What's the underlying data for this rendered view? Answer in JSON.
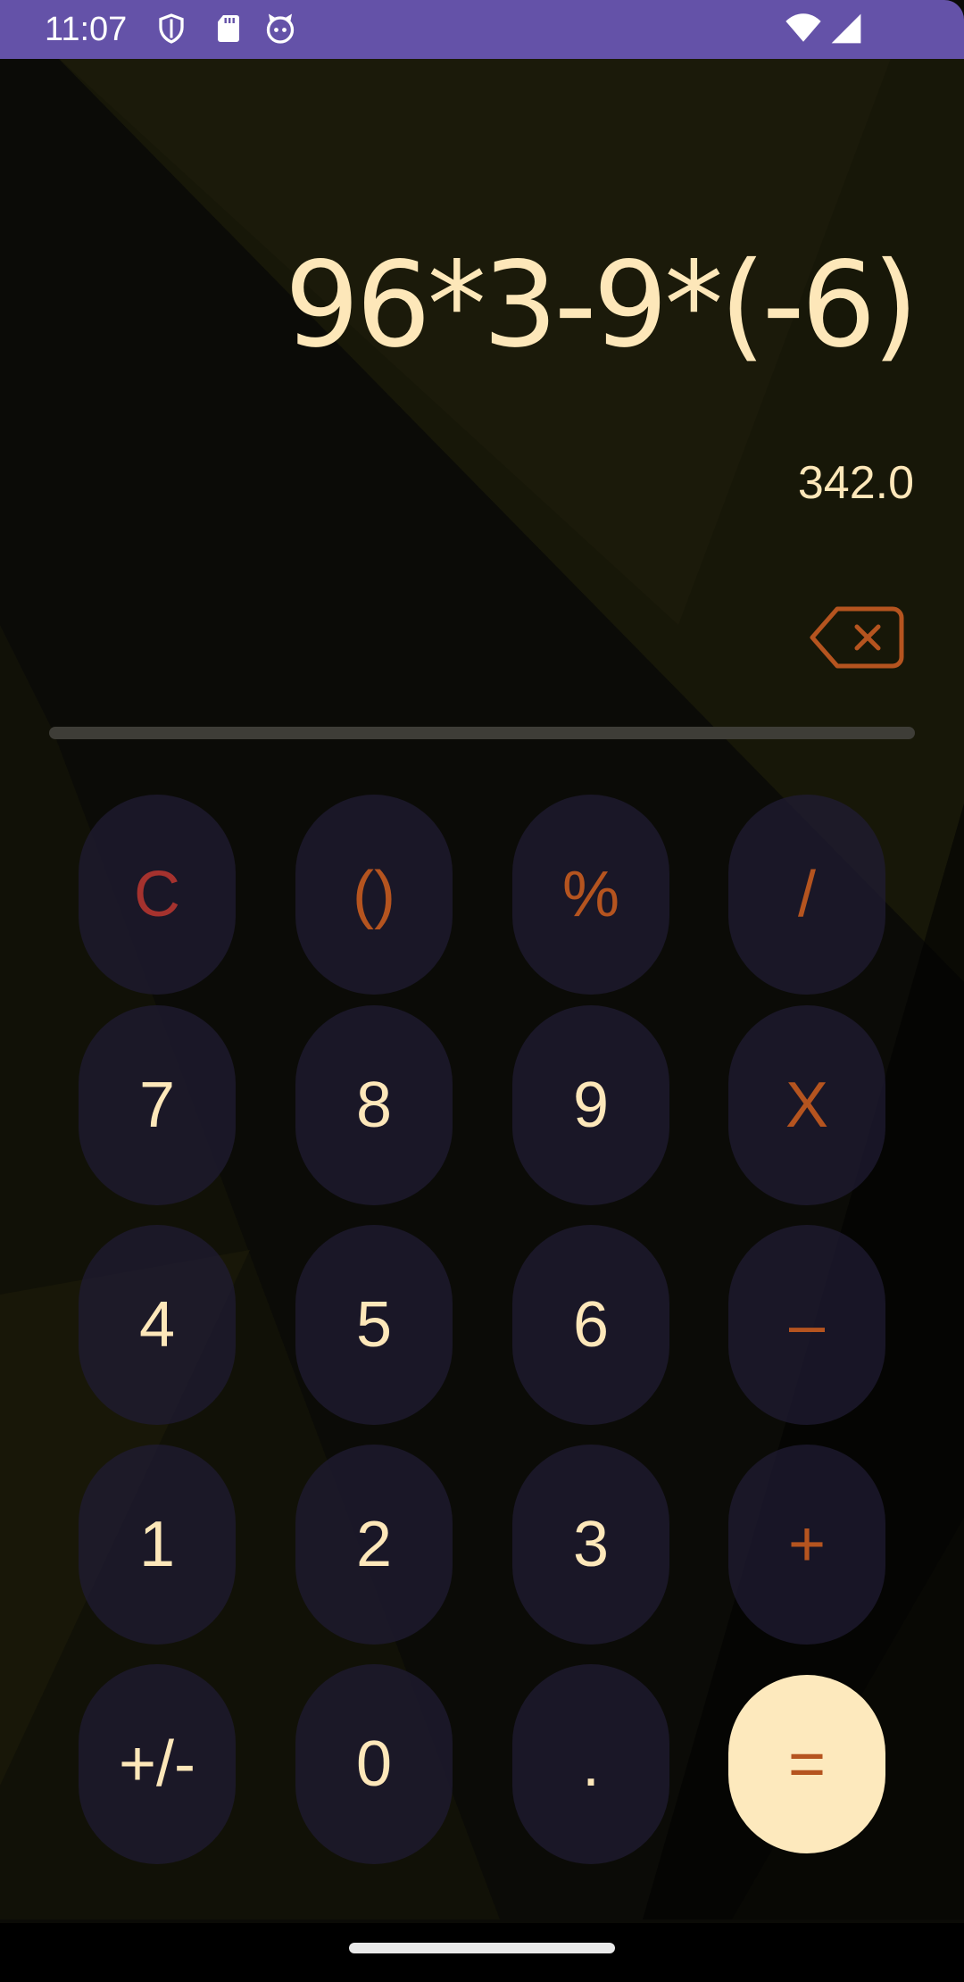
{
  "status_bar": {
    "time": "11:07",
    "icons": [
      "shield-icon",
      "sd-card-icon",
      "cat-face-icon",
      "wifi-icon",
      "signal-icon"
    ],
    "color": "#6452a8"
  },
  "display": {
    "expression": "96*3-9*(-6)",
    "result": "342.0",
    "backspace_icon": "backspace-icon"
  },
  "keypad": {
    "row1": [
      "C",
      "()",
      "%",
      "/"
    ],
    "row2": [
      "7",
      "8",
      "9",
      "X"
    ],
    "row3": [
      "4",
      "5",
      "6",
      "–"
    ],
    "row4": [
      "1",
      "2",
      "3",
      "+"
    ],
    "row5": [
      "+/-",
      "0",
      ".",
      "="
    ]
  },
  "colors": {
    "digit_text": "#fde7b9",
    "operator_text": "#b5541f",
    "clear_text": "#a5322e",
    "equals_bg": "#fde9bd",
    "key_bg": "#201c34"
  }
}
